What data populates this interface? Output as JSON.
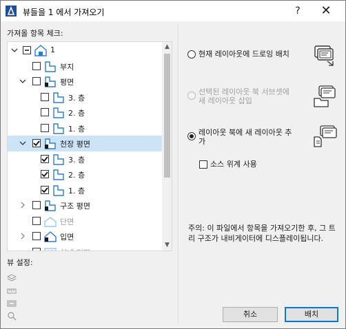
{
  "window": {
    "title": "뷰들을 1 에서 가져오기",
    "help_label": "?",
    "close_label": "✕"
  },
  "left_panel": {
    "label": "가져올 항목 체크:",
    "tree": [
      {
        "label": "1",
        "expander": "open",
        "check": "partial",
        "icon": "project-icon",
        "level": 0
      },
      {
        "label": "부지",
        "expander": "none",
        "check": "unchecked",
        "icon": "plan-view-icon",
        "level": 1
      },
      {
        "label": "평면",
        "expander": "open",
        "check": "unchecked",
        "icon": "floor-plan-folder-icon",
        "level": 1
      },
      {
        "label": "3. 층",
        "expander": "none",
        "check": "unchecked",
        "icon": "plan-view-icon",
        "level": 2
      },
      {
        "label": "2. 층",
        "expander": "none",
        "check": "unchecked",
        "icon": "plan-view-icon",
        "level": 2
      },
      {
        "label": "1. 층",
        "expander": "none",
        "check": "unchecked",
        "icon": "plan-view-icon",
        "level": 2
      },
      {
        "label": "천장 평면",
        "expander": "open",
        "check": "checked",
        "icon": "ceiling-plan-folder-icon",
        "level": 1,
        "selected": true
      },
      {
        "label": "3. 층",
        "expander": "none",
        "check": "checked",
        "icon": "plan-view-icon",
        "level": 2
      },
      {
        "label": "2. 층",
        "expander": "none",
        "check": "checked",
        "icon": "plan-view-icon",
        "level": 2
      },
      {
        "label": "1. 층",
        "expander": "none",
        "check": "checked",
        "icon": "plan-view-icon",
        "level": 2
      },
      {
        "label": "구조 평면",
        "expander": "closed",
        "check": "unchecked",
        "icon": "structural-plan-folder-icon",
        "level": 1
      },
      {
        "label": "단면",
        "expander": "none",
        "check": "unchecked",
        "icon": "section-icon",
        "level": 1,
        "disabled": true
      },
      {
        "label": "입면",
        "expander": "closed",
        "check": "unchecked",
        "icon": "elevation-icon",
        "level": 1
      },
      {
        "label": "실내 입면",
        "expander": "none",
        "check": "unchecked",
        "icon": "interior-elevation-icon",
        "level": 1,
        "disabled": true
      }
    ],
    "scroll_up": "▲",
    "scroll_down": "▼",
    "view_settings_label": "뷰 설정:"
  },
  "right_panel": {
    "options": [
      {
        "label": "현재 레이아웃에 드로잉 배치",
        "selected": false,
        "disabled": false,
        "icon": "place-drawing-icon"
      },
      {
        "label": "선택된 레이아웃 북 서브셋에\n새 레이아웃 삽입",
        "selected": false,
        "disabled": true,
        "icon": "layout-subset-folder-icon"
      },
      {
        "label": "레이아웃 북에 새 레이아웃 추\n가",
        "selected": true,
        "disabled": false,
        "icon": "layout-book-add-icon"
      }
    ],
    "use_source_hierarchy_label": "소스 위계 사용",
    "use_source_hierarchy_checked": false,
    "note": "주의: 이 파일에서 항목을 가져오기한 후, 그 트리 구조가 내비게이터에 디스플레이됩니다."
  },
  "buttons": {
    "cancel": "취소",
    "place": "배치"
  },
  "colors": {
    "selection": "#cce4f7",
    "icon_blue": "#2b7bd6",
    "primary_border": "#0078d7"
  }
}
